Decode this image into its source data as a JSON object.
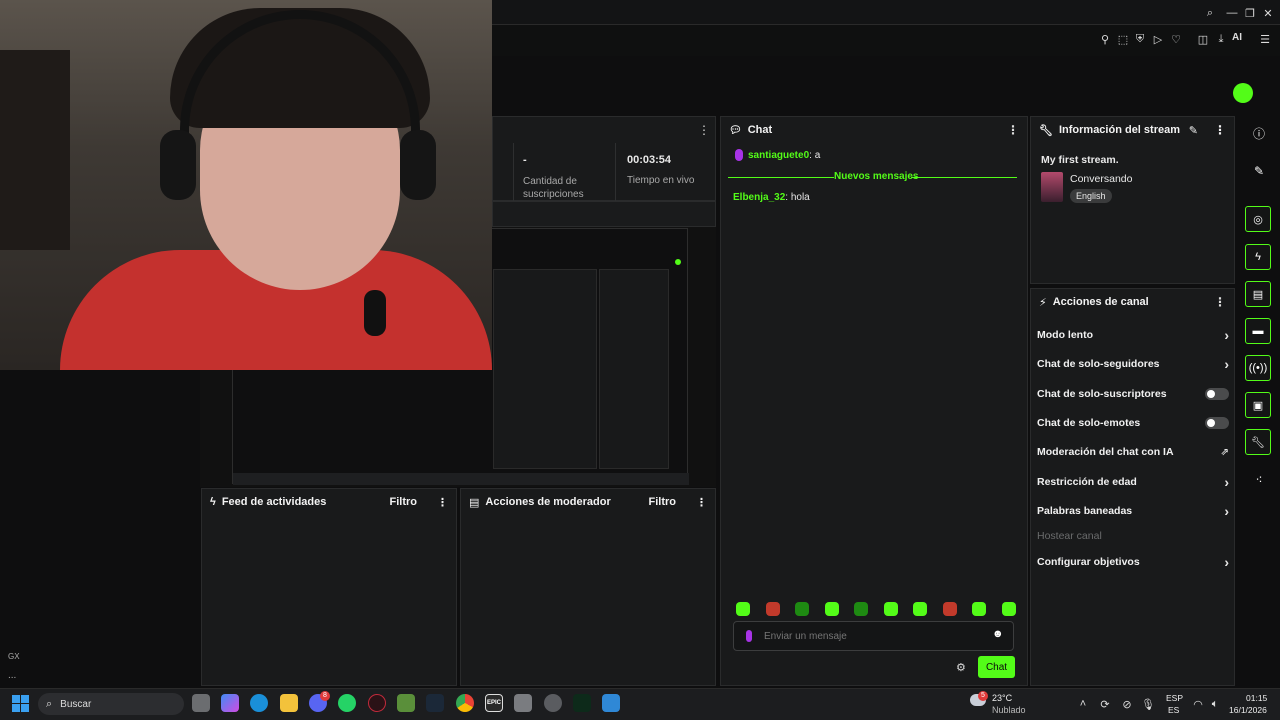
{
  "topbar": {
    "window_controls": [
      "search-icon",
      "minimize-icon",
      "restore-icon",
      "close-icon"
    ]
  },
  "toolbar": {
    "ai_label": "AI"
  },
  "stats": {
    "subs_value": "-",
    "subs_label": "Cantidad de suscripciones",
    "time_value": "00:03:54",
    "time_label": "Tiempo en vivo"
  },
  "chat": {
    "title": "Chat",
    "messages": [
      {
        "user": "santiaguete0",
        "text": ": a",
        "user_color": "#53fc18"
      },
      {
        "user": "Elbenja_32",
        "text": ": hola",
        "user_color": "#53fc18"
      }
    ],
    "new_messages_label": "Nuevos mensajes",
    "input_placeholder": "Enviar un mensaje",
    "send_label": "Chat"
  },
  "stream_info": {
    "title": "Información del stream",
    "stream_title": "My first stream.",
    "category": "Conversando",
    "language": "English"
  },
  "channel_actions": {
    "title": "Acciones de canal",
    "items": [
      {
        "label": "Modo lento",
        "type": "chevron"
      },
      {
        "label": "Chat de solo-seguidores",
        "type": "chevron"
      },
      {
        "label": "Chat de solo-suscriptores",
        "type": "toggle"
      },
      {
        "label": "Chat de solo-emotes",
        "type": "toggle"
      },
      {
        "label": "Moderación del chat con IA",
        "type": "external"
      },
      {
        "label": "Restricción de edad",
        "type": "chevron"
      },
      {
        "label": "Palabras baneadas",
        "type": "chevron"
      },
      {
        "label": "Hostear canal",
        "type": "disabled"
      },
      {
        "label": "Configurar objetivos",
        "type": "chevron"
      }
    ]
  },
  "activity_feed": {
    "title": "Feed de actividades",
    "filter": "Filtro"
  },
  "mod_actions": {
    "title": "Acciones de moderador",
    "filter": "Filtro"
  },
  "left_sidebar": {
    "gx_label": "GX",
    "more_label": "..."
  },
  "taskbar": {
    "search_placeholder": "Buscar",
    "weather_temp": "23°C",
    "weather_desc": "Nublado",
    "weather_badge": "5",
    "discord_badge": "8",
    "lang_top": "ESP",
    "lang_bottom": "ES",
    "time": "01:15",
    "date": "16/1/2026"
  },
  "colors": {
    "accent": "#53fc18",
    "panel": "#191a1b",
    "bg": "#0e0e0f"
  }
}
